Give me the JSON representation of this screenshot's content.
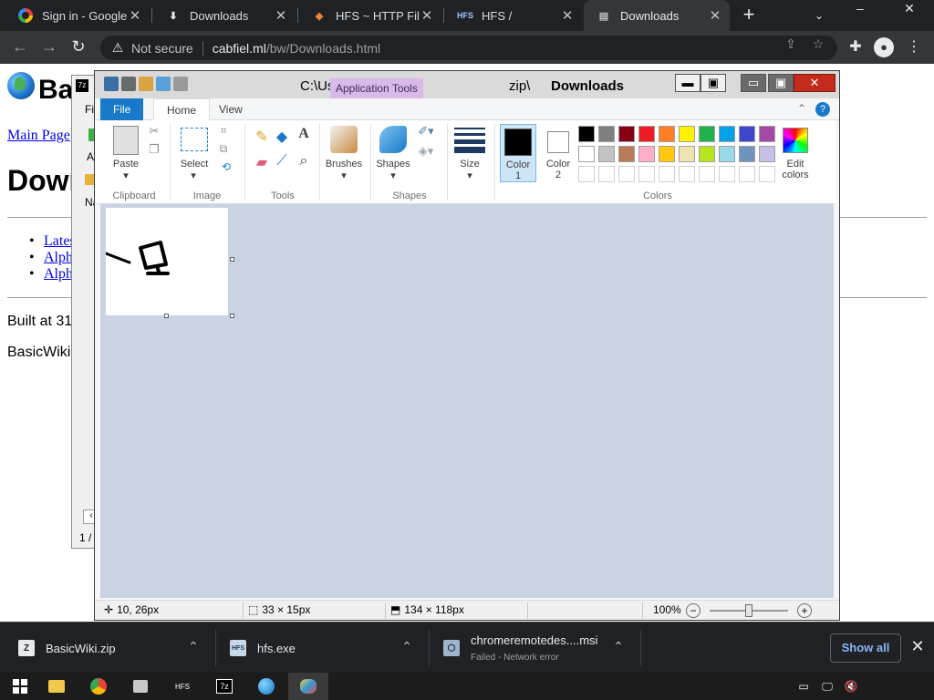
{
  "browser": {
    "tabs": [
      {
        "title": "Sign in - Google A",
        "icon": "google-icon"
      },
      {
        "title": "Downloads",
        "icon": "download-icon"
      },
      {
        "title": "HFS ~ HTTP File S",
        "icon": "hfs-diamond-icon"
      },
      {
        "title": "HFS /",
        "icon": "hfs-icon"
      },
      {
        "title": "Downloads",
        "icon": "page-icon",
        "active": true
      }
    ],
    "new_tab": "+",
    "omnibox": {
      "security_label": "Not secure",
      "host": "cabfiel.ml",
      "path": "/bw/Downloads.html"
    }
  },
  "page": {
    "site_title": "BasicWiki",
    "main_page_link": "Main Page",
    "heading": "Downloads",
    "list": [
      "Latest",
      "Alpha",
      "Alpha"
    ],
    "built_text": "Built at 31.",
    "footer_text": "BasicWiki A"
  },
  "zip_window": {
    "menu_file": "File",
    "add_label": "Ad",
    "col_name": "Na",
    "status": "1 / 1"
  },
  "paint": {
    "app_tools_label": "Application Tools",
    "title": "Downloads",
    "title_ghost": "C:\\Us",
    "title_ghost_2": "zip\\",
    "tabs": {
      "file": "File",
      "home": "Home",
      "view": "View"
    },
    "groups": {
      "clipboard": "Clipboard",
      "image": "Image",
      "tools": "Tools",
      "shapes": "Shapes",
      "colors": "Colors"
    },
    "buttons": {
      "paste": "Paste",
      "select": "Select",
      "brushes": "Brushes",
      "shapes": "Shapes",
      "size": "Size",
      "color1": "Color\n1",
      "color1_a": "Color",
      "color1_b": "1",
      "color2_a": "Color",
      "color2_b": "2",
      "edit_a": "Edit",
      "edit_b": "colors"
    },
    "palette_row1": [
      "#000000",
      "#7f7f7f",
      "#880015",
      "#ed1c24",
      "#ff7f27",
      "#fff200",
      "#22b14c",
      "#00a2e8",
      "#3f48cc",
      "#a349a4"
    ],
    "palette_row2": [
      "#ffffff",
      "#c3c3c3",
      "#b97a57",
      "#ffaec9",
      "#ffc90e",
      "#efe4b0",
      "#b5e61d",
      "#99d9ea",
      "#7092be",
      "#c8bfe7"
    ],
    "status": {
      "cursor": "10, 26px",
      "selection": "33 × 15px",
      "image_size": "134 × 118px",
      "zoom": "100%"
    }
  },
  "downloads": {
    "items": [
      {
        "name": "BasicWiki.zip",
        "status": ""
      },
      {
        "name": "hfs.exe",
        "status": ""
      },
      {
        "name": "chromeremotedes....msi",
        "status": "Failed - Network error"
      }
    ],
    "show_all": "Show all"
  },
  "taskbar": {
    "apps": [
      "start",
      "explorer",
      "chrome",
      "files",
      "hfs",
      "7zip",
      "wiki",
      "paint"
    ]
  }
}
